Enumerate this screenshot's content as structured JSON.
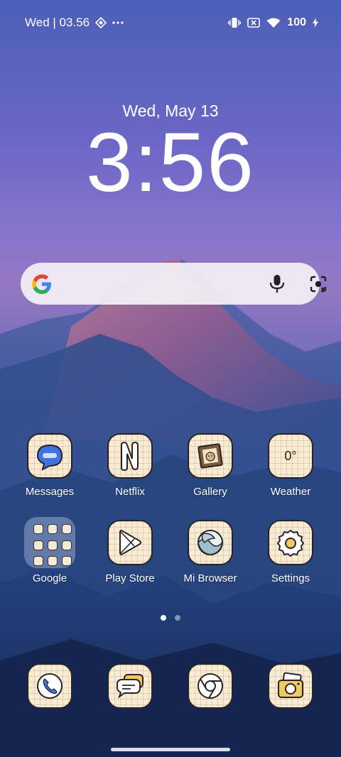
{
  "status_bar": {
    "datetime": "Wed | 03.56",
    "battery": "100",
    "icons": [
      "vibrate-icon",
      "no-sim-icon",
      "wifi-icon",
      "charging-icon"
    ]
  },
  "clock": {
    "date": "Wed, May 13",
    "time": "3:56"
  },
  "search": {
    "icons": [
      "google-logo-icon",
      "mic-icon",
      "lens-icon"
    ]
  },
  "apps": {
    "messages": "Messages",
    "netflix": "Netflix",
    "gallery": "Gallery",
    "weather": "Weather",
    "weather_temp": "0°",
    "google": "Google",
    "play_store": "Play Store",
    "mi_browser": "Mi Browser",
    "settings": "Settings"
  },
  "dock": [
    "phone-icon",
    "chat-icon",
    "chrome-icon",
    "camera-icon"
  ],
  "pages": {
    "count": 2,
    "active": 1
  },
  "colors": {
    "icon_bg": "#f8ecd6",
    "icon_border": "#2a2324",
    "search_bg": "#f4f0f6"
  }
}
